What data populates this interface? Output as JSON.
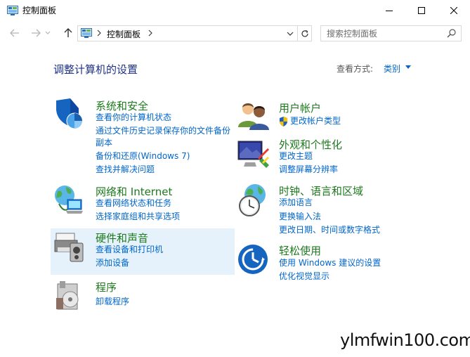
{
  "window": {
    "title": "控制面板"
  },
  "address": {
    "crumb": "控制面板",
    "search_placeholder": "搜索控制面板"
  },
  "main": {
    "title": "调整计算机的设置",
    "view_by_label": "查看方式:",
    "view_by_value": "类别"
  },
  "categories": {
    "system": {
      "heading": "系统和安全",
      "links": [
        "查看你的计算机状态",
        "通过文件历史记录保存你的文件备份",
        "副本",
        "备份和还原(Windows 7)",
        "查找并解决问题"
      ]
    },
    "network": {
      "heading": "网络和 Internet",
      "links": [
        "查看网络状态和任务",
        "选择家庭组和共享选项"
      ]
    },
    "hardware": {
      "heading": "硬件和声音",
      "links": [
        "查看设备和打印机",
        "添加设备"
      ]
    },
    "programs": {
      "heading": "程序",
      "links": [
        "卸载程序"
      ]
    },
    "users": {
      "heading": "用户帐户",
      "links": [
        "更改帐户类型"
      ]
    },
    "appearance": {
      "heading": "外观和个性化",
      "links": [
        "更改主题",
        "调整屏幕分辨率"
      ]
    },
    "clock": {
      "heading": "时钟、语言和区域",
      "links": [
        "添加语言",
        "更换输入法",
        "更改日期、时间或数字格式"
      ]
    },
    "ease": {
      "heading": "轻松使用",
      "links": [
        "使用 Windows 建议的设置",
        "优化视觉显示"
      ]
    }
  },
  "watermark": "ylmfwin100.com",
  "colors": {
    "heading_green": "#1d7a1d",
    "link_blue": "#0066cc",
    "title_blue": "#1e3287",
    "hover_bg": "#e6f2fb"
  }
}
